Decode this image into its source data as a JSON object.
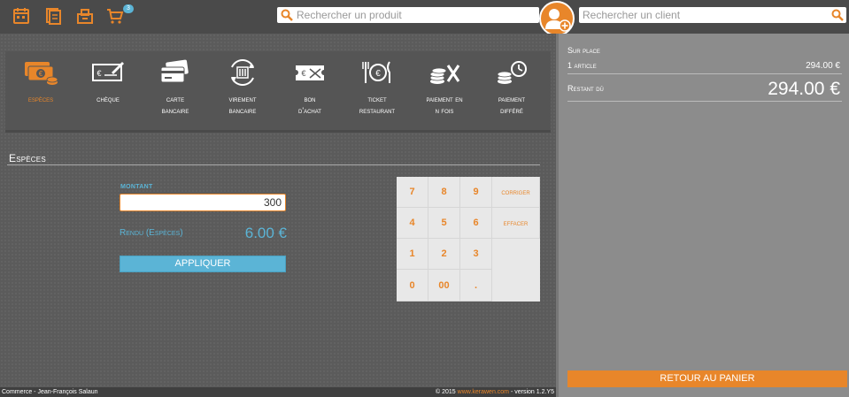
{
  "header": {
    "icons": [
      "calendar-icon",
      "document-icon",
      "cash-drawer-icon",
      "cart-icon"
    ],
    "cart_count": "3",
    "product_search_placeholder": "Rechercher un produit",
    "client_search_placeholder": "Rechercher un client"
  },
  "payment_methods": [
    {
      "id": "especes",
      "label": "Espèces",
      "icon": "cash-icon",
      "active": true
    },
    {
      "id": "cheque",
      "label": "Chèque",
      "icon": "cheque-icon",
      "active": false
    },
    {
      "id": "carte",
      "label": "Carte\nbancaire",
      "icon": "credit-card-icon",
      "active": false
    },
    {
      "id": "virement",
      "label": "Virement\nbancaire",
      "icon": "bank-transfer-icon",
      "active": false
    },
    {
      "id": "bon",
      "label": "Bon\nd'achat",
      "icon": "voucher-icon",
      "active": false
    },
    {
      "id": "ticket",
      "label": "Ticket\nrestaurant",
      "icon": "meal-ticket-icon",
      "active": false
    },
    {
      "id": "plusieurs",
      "label": "Paiement en\nN fois",
      "icon": "installments-icon",
      "active": false
    },
    {
      "id": "differe",
      "label": "Paiement\ndifféré",
      "icon": "deferred-payment-icon",
      "active": false
    }
  ],
  "section": {
    "title": "Espèces",
    "amount_label": "MONTANT",
    "amount_value": "300",
    "change_label": "Rendu (Espèces)",
    "change_value": "6.00 €",
    "apply_label": "APPLIQUER"
  },
  "keypad": {
    "keys": [
      "7",
      "8",
      "9",
      "4",
      "5",
      "6",
      "1",
      "2",
      "3",
      "0",
      "00",
      "."
    ],
    "correct_label": "Corriger",
    "clear_label": "Effacer"
  },
  "footer": {
    "left": "Commerce - Jean-François Salaun",
    "copyright": "© 2015",
    "link": "www.kerawen.com",
    "version": "- version 1.2.Y5"
  },
  "summary": {
    "context": "Sur place",
    "qty_label": "1 article",
    "qty_amount": "294.00 €",
    "due_label": "Restant dû",
    "due_amount": "294.00 €",
    "back_label": "RETOUR AU PANIER"
  },
  "colors": {
    "accent": "#e8862a",
    "info": "#5bb4d6",
    "panel": "#8c8c8c"
  }
}
